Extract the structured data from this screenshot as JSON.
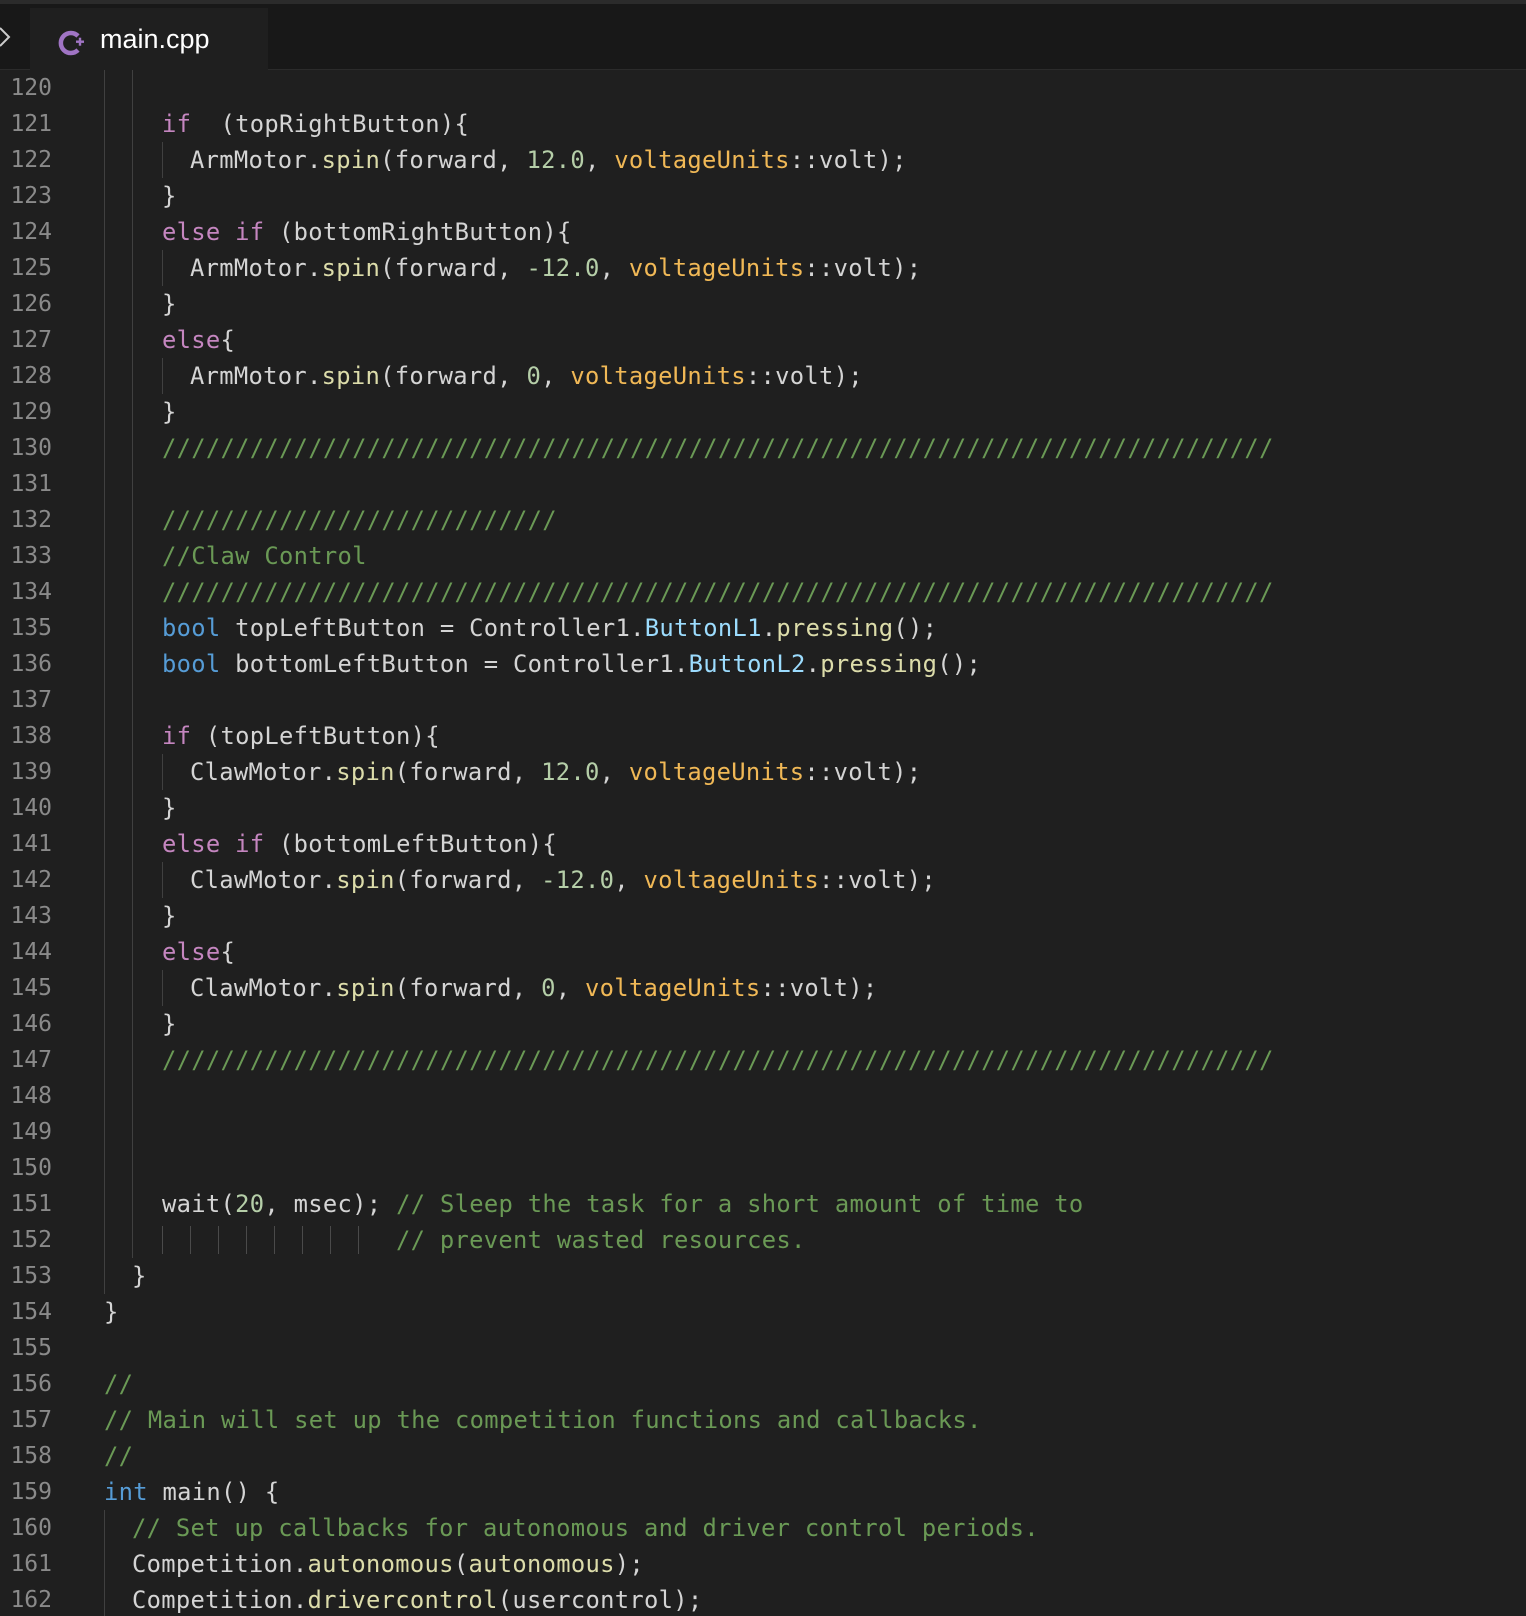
{
  "tab": {
    "filename": "main.cpp",
    "icon": "cpp-file-icon"
  },
  "colors": {
    "background": "#1f1f1f",
    "keyword": "#c586c0",
    "type": "#569cd6",
    "function": "#dcdcaa",
    "number": "#b5cea8",
    "enum": "#f0b856",
    "property": "#9cdcfe",
    "comment": "#6a9955",
    "text": "#d4d4d4",
    "line_number": "#8a8a8a"
  },
  "lines": [
    {
      "num": "120",
      "indent": 0,
      "tokens": []
    },
    {
      "num": "121",
      "indent": 2,
      "tokens": [
        [
          "k",
          "if"
        ],
        [
          "",
          "  (topRightButton){"
        ]
      ]
    },
    {
      "num": "122",
      "indent": 3,
      "tokens": [
        [
          "",
          "ArmMotor."
        ],
        [
          "f",
          "spin"
        ],
        [
          "",
          "(forward, "
        ],
        [
          "n",
          "12.0"
        ],
        [
          "",
          ", "
        ],
        [
          "e",
          "voltageUnits"
        ],
        [
          "",
          "::volt);"
        ]
      ]
    },
    {
      "num": "123",
      "indent": 2,
      "tokens": [
        [
          "",
          "}"
        ]
      ]
    },
    {
      "num": "124",
      "indent": 2,
      "tokens": [
        [
          "k",
          "else"
        ],
        [
          "",
          " "
        ],
        [
          "k",
          "if"
        ],
        [
          "",
          " (bottomRightButton){"
        ]
      ]
    },
    {
      "num": "125",
      "indent": 3,
      "tokens": [
        [
          "",
          "ArmMotor."
        ],
        [
          "f",
          "spin"
        ],
        [
          "",
          "(forward, "
        ],
        [
          "n",
          "-12.0"
        ],
        [
          "",
          ", "
        ],
        [
          "e",
          "voltageUnits"
        ],
        [
          "",
          "::volt);"
        ]
      ]
    },
    {
      "num": "126",
      "indent": 2,
      "tokens": [
        [
          "",
          "}"
        ]
      ]
    },
    {
      "num": "127",
      "indent": 2,
      "tokens": [
        [
          "k",
          "else"
        ],
        [
          "",
          "{"
        ]
      ]
    },
    {
      "num": "128",
      "indent": 3,
      "tokens": [
        [
          "",
          "ArmMotor."
        ],
        [
          "f",
          "spin"
        ],
        [
          "",
          "(forward, "
        ],
        [
          "n",
          "0"
        ],
        [
          "",
          ", "
        ],
        [
          "e",
          "voltageUnits"
        ],
        [
          "",
          "::volt);"
        ]
      ]
    },
    {
      "num": "129",
      "indent": 2,
      "tokens": [
        [
          "",
          "}"
        ]
      ]
    },
    {
      "num": "130",
      "indent": 2,
      "tokens": [
        [
          "cx",
          "////////////////////////////////////////////////////////////////////////////"
        ]
      ]
    },
    {
      "num": "131",
      "indent": 0,
      "tokens": []
    },
    {
      "num": "132",
      "indent": 2,
      "tokens": [
        [
          "cx",
          "///////////////////////////"
        ]
      ]
    },
    {
      "num": "133",
      "indent": 2,
      "tokens": [
        [
          "c",
          "//Claw Control"
        ]
      ]
    },
    {
      "num": "134",
      "indent": 2,
      "tokens": [
        [
          "cx",
          "////////////////////////////////////////////////////////////////////////////"
        ]
      ]
    },
    {
      "num": "135",
      "indent": 2,
      "tokens": [
        [
          "t",
          "bool"
        ],
        [
          "",
          " topLeftButton = Controller1."
        ],
        [
          "p",
          "ButtonL1"
        ],
        [
          "",
          "."
        ],
        [
          "f",
          "pressing"
        ],
        [
          "",
          "();"
        ]
      ]
    },
    {
      "num": "136",
      "indent": 2,
      "tokens": [
        [
          "t",
          "bool"
        ],
        [
          "",
          " bottomLeftButton = Controller1."
        ],
        [
          "p",
          "ButtonL2"
        ],
        [
          "",
          "."
        ],
        [
          "f",
          "pressing"
        ],
        [
          "",
          "();"
        ]
      ]
    },
    {
      "num": "137",
      "indent": 0,
      "tokens": []
    },
    {
      "num": "138",
      "indent": 2,
      "tokens": [
        [
          "k",
          "if"
        ],
        [
          "",
          " (topLeftButton){"
        ]
      ]
    },
    {
      "num": "139",
      "indent": 3,
      "tokens": [
        [
          "",
          "ClawMotor."
        ],
        [
          "f",
          "spin"
        ],
        [
          "",
          "(forward, "
        ],
        [
          "n",
          "12.0"
        ],
        [
          "",
          ", "
        ],
        [
          "e",
          "voltageUnits"
        ],
        [
          "",
          "::volt);"
        ]
      ]
    },
    {
      "num": "140",
      "indent": 2,
      "tokens": [
        [
          "",
          "}"
        ]
      ]
    },
    {
      "num": "141",
      "indent": 2,
      "tokens": [
        [
          "k",
          "else"
        ],
        [
          "",
          " "
        ],
        [
          "k",
          "if"
        ],
        [
          "",
          " (bottomLeftButton){"
        ]
      ]
    },
    {
      "num": "142",
      "indent": 3,
      "tokens": [
        [
          "",
          "ClawMotor."
        ],
        [
          "f",
          "spin"
        ],
        [
          "",
          "(forward, "
        ],
        [
          "n",
          "-12.0"
        ],
        [
          "",
          ", "
        ],
        [
          "e",
          "voltageUnits"
        ],
        [
          "",
          "::volt);"
        ]
      ]
    },
    {
      "num": "143",
      "indent": 2,
      "tokens": [
        [
          "",
          "}"
        ]
      ]
    },
    {
      "num": "144",
      "indent": 2,
      "tokens": [
        [
          "k",
          "else"
        ],
        [
          "",
          "{"
        ]
      ]
    },
    {
      "num": "145",
      "indent": 3,
      "tokens": [
        [
          "",
          "ClawMotor."
        ],
        [
          "f",
          "spin"
        ],
        [
          "",
          "(forward, "
        ],
        [
          "n",
          "0"
        ],
        [
          "",
          ", "
        ],
        [
          "e",
          "voltageUnits"
        ],
        [
          "",
          "::volt);"
        ]
      ]
    },
    {
      "num": "146",
      "indent": 2,
      "tokens": [
        [
          "",
          "}"
        ]
      ]
    },
    {
      "num": "147",
      "indent": 2,
      "tokens": [
        [
          "cx",
          "////////////////////////////////////////////////////////////////////////////"
        ]
      ]
    },
    {
      "num": "148",
      "indent": 0,
      "tokens": []
    },
    {
      "num": "149",
      "indent": 0,
      "tokens": []
    },
    {
      "num": "150",
      "indent": 0,
      "tokens": []
    },
    {
      "num": "151",
      "indent": 2,
      "tokens": [
        [
          "",
          "wait("
        ],
        [
          "n",
          "20"
        ],
        [
          "",
          ", msec); "
        ],
        [
          "c",
          "// Sleep the task for a short amount of time to"
        ]
      ]
    },
    {
      "num": "152",
      "indent": 2,
      "tokens": [
        [
          "",
          "                "
        ],
        [
          "c",
          "// prevent wasted resources."
        ]
      ]
    },
    {
      "num": "153",
      "indent": 1,
      "tokens": [
        [
          "",
          "}"
        ]
      ]
    },
    {
      "num": "154",
      "indent": 0,
      "tokens": [
        [
          "",
          "}"
        ]
      ]
    },
    {
      "num": "155",
      "indent": -1,
      "tokens": []
    },
    {
      "num": "156",
      "indent": 0,
      "tokens": [
        [
          "c",
          "//"
        ]
      ]
    },
    {
      "num": "157",
      "indent": 0,
      "tokens": [
        [
          "c",
          "// Main will set up the competition functions and callbacks."
        ]
      ]
    },
    {
      "num": "158",
      "indent": 0,
      "tokens": [
        [
          "c",
          "//"
        ]
      ]
    },
    {
      "num": "159",
      "indent": 0,
      "tokens": [
        [
          "t",
          "int"
        ],
        [
          "",
          " main() {"
        ]
      ]
    },
    {
      "num": "160",
      "indent": 1,
      "tokens": [
        [
          "c",
          "// Set up callbacks for autonomous and driver control periods."
        ]
      ]
    },
    {
      "num": "161",
      "indent": 1,
      "tokens": [
        [
          "",
          "Competition."
        ],
        [
          "f",
          "autonomous"
        ],
        [
          "",
          "("
        ],
        [
          "f",
          "autonomous"
        ],
        [
          "",
          ");"
        ]
      ]
    },
    {
      "num": "162",
      "indent": 1,
      "tokens": [
        [
          "",
          "Competition."
        ],
        [
          "f",
          "drivercontrol"
        ],
        [
          "",
          "(usercontrol);"
        ]
      ]
    }
  ]
}
